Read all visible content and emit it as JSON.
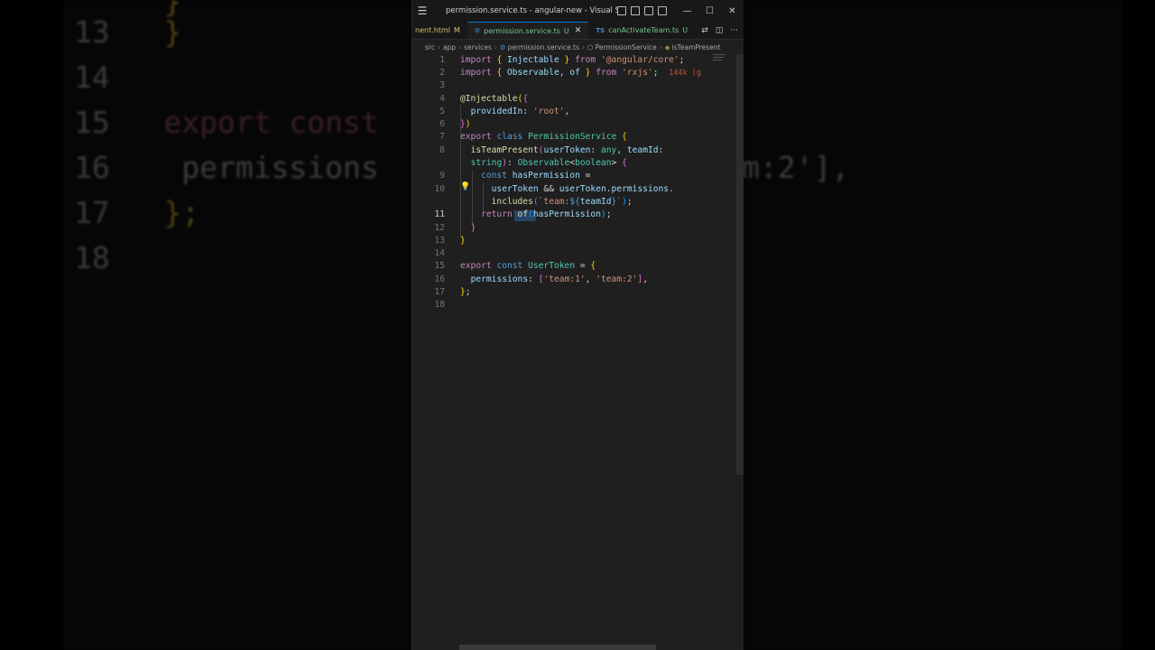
{
  "window": {
    "title": "permission.service.ts - angular-new - Visual Studio ...",
    "controls": {
      "minimize": "—",
      "maximize": "☐",
      "close": "✕"
    }
  },
  "tabs": [
    {
      "label": "nent.html",
      "mod": "M",
      "active": false
    },
    {
      "label": "permission.service.ts",
      "mod": "U",
      "active": true
    },
    {
      "label": "canActivateTeam.ts",
      "mod": "U",
      "active": false
    }
  ],
  "breadcrumb": [
    "src",
    "app",
    "services",
    "permission.service.ts",
    "PermissionService",
    "isTeamPresent"
  ],
  "editor": {
    "current_line": "11",
    "inlay_hint": "144k (g",
    "line_numbers": [
      "1",
      "2",
      "3",
      "4",
      "5",
      "6",
      "7",
      "8",
      "",
      "9",
      "10",
      "",
      "11",
      "12",
      "13",
      "14",
      "15",
      "16",
      "17",
      "18"
    ]
  },
  "background": {
    "left_lines": [
      {
        "num": "13",
        "code": "}"
      },
      {
        "num": "14",
        "code": ""
      },
      {
        "num": "15",
        "code": "export const"
      },
      {
        "num": "16",
        "code": "permissions"
      },
      {
        "num": "17",
        "code": "};"
      },
      {
        "num": "18",
        "code": ""
      }
    ],
    "right_fragment": "m:2'],"
  },
  "colors": {
    "editor_bg": "#1f1f1f",
    "keyword": "#569cd6",
    "class": "#4ec9b0",
    "function": "#dcdcaa",
    "string": "#ce9178",
    "active_tab_accent": "#0078d4"
  }
}
